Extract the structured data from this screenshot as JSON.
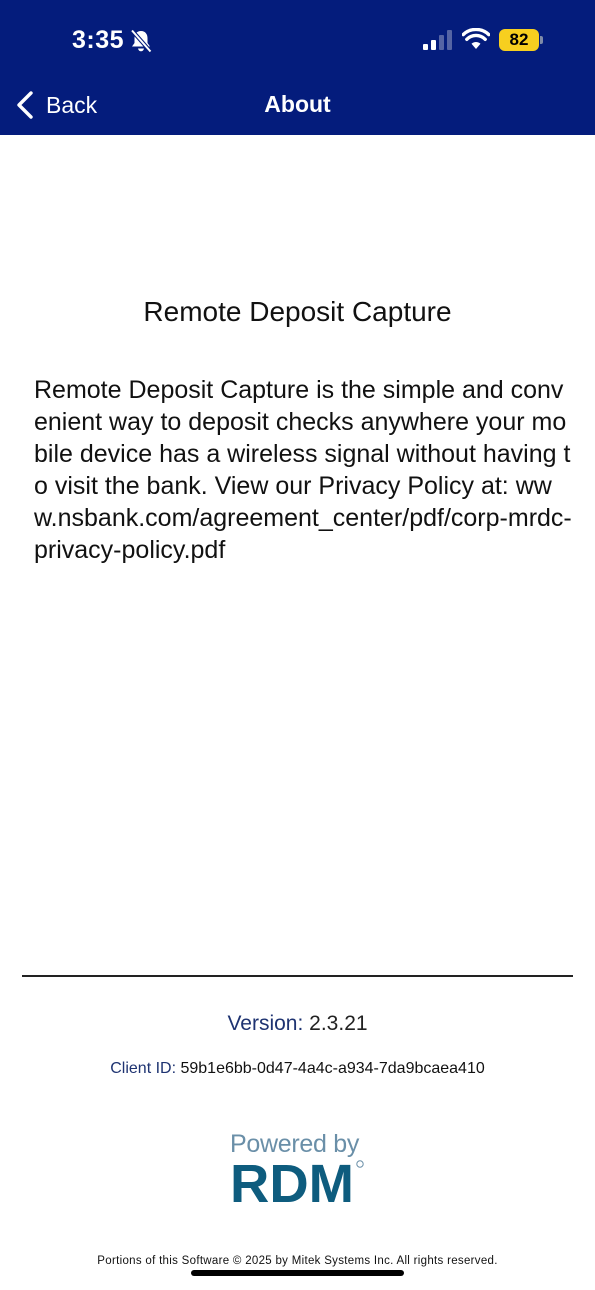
{
  "status_bar": {
    "time": "3:35",
    "battery_level": "82",
    "icons": [
      "bell-slash-icon",
      "cellular-signal-icon",
      "wifi-icon",
      "battery-icon"
    ],
    "colors": {
      "bar": "#041c7c",
      "battery": "#f7cf1f"
    }
  },
  "nav": {
    "back_label": "Back",
    "title": "About"
  },
  "content": {
    "heading": "Remote Deposit Capture",
    "description": "Remote Deposit Capture is the simple and convenient way to deposit checks anywhere your mobile device has a wireless signal without having to visit the bank. View our Privacy Policy at: www.nsbank.com/agreement_center/pdf/corp-mrdc-privacy-policy.pdf"
  },
  "footer": {
    "version_label": "Version:",
    "version_value": "2.3.21",
    "client_id_label": "Client ID:",
    "client_id_value": "59b1e6bb-0d47-4a4c-a934-7da9bcaea410",
    "powered_by": "Powered by",
    "logo_text": "RDM",
    "copyright": "Portions of this Software © 2025 by Mitek Systems Inc. All rights reserved."
  }
}
